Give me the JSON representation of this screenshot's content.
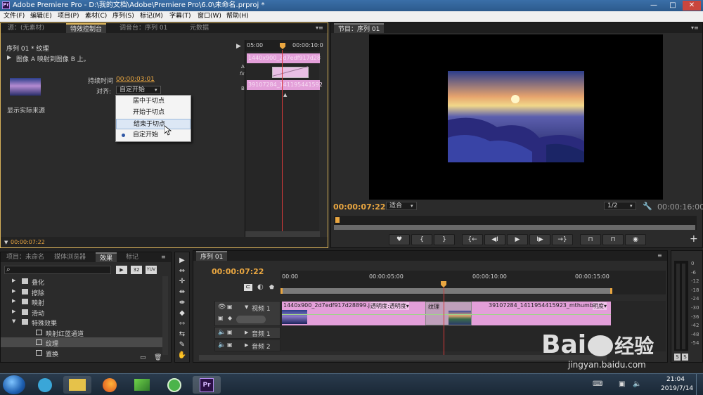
{
  "window": {
    "app_logo": "Pr",
    "title": "Adobe Premiere Pro - D:\\我的文档\\Adobe\\Premiere Pro\\6.0\\未命名.prproj *",
    "minimize": "—",
    "maximize": "□",
    "close": "✕"
  },
  "menu": [
    "文件(F)",
    "编辑(E)",
    "项目(P)",
    "素材(C)",
    "序列(S)",
    "标记(M)",
    "字幕(T)",
    "窗口(W)",
    "帮助(H)"
  ],
  "source_panel": {
    "tabs": [
      "源：(无素材)",
      "特效控制台",
      "调音台：序列 01",
      "元数据"
    ],
    "sequence_label": "序列 01 * 纹理",
    "description": "图像 A 映射到图像 B 上。",
    "duration_label": "持续时间",
    "duration_value": "00:00:03:01",
    "align_label": "对齐:",
    "align_value": "自定开始",
    "show_actual": "显示实际来源",
    "ruler_start": "05:00",
    "ruler_mid": "00:00:10:0",
    "track_a": "A",
    "track_b": "B",
    "fx": "fx",
    "clip_a_label": "1440x900_2d7edf917d28",
    "clip_b_label": "39107284_141195441592",
    "footer_timecode": "00:00:07:22",
    "dropdown_options": [
      "居中于切点",
      "开始于切点",
      "结束于切点",
      "自定开始"
    ],
    "dropdown_highlighted": 2,
    "dropdown_selected": 3
  },
  "program_panel": {
    "tab": "节目：序列 01",
    "timecode": "00:00:07:22",
    "fit": "适合",
    "resolution": "1/2",
    "duration": "00:00:16:00",
    "buttons": [
      "marker",
      "in-point",
      "out-point",
      "go-to-in",
      "step-back",
      "play",
      "step-forward",
      "go-to-out",
      "lift",
      "extract",
      "export-frame"
    ],
    "button_glyphs": [
      "♥",
      "{",
      "}",
      "{←",
      "◀I",
      "▶",
      "I▶",
      "→}",
      "⊓",
      "⊓",
      "◉"
    ],
    "add": "+"
  },
  "project_panel": {
    "tabs": [
      "项目：未命名",
      "媒体浏览器",
      "效果",
      "标记"
    ],
    "search_icon": "⌕",
    "chip_a": "▶",
    "chip_b": "32",
    "chip_c": "YUV",
    "tree": [
      {
        "label": "叠化",
        "type": "folder",
        "indent": 0
      },
      {
        "label": "擦除",
        "type": "folder",
        "indent": 0
      },
      {
        "label": "映射",
        "type": "folder",
        "indent": 0
      },
      {
        "label": "滑动",
        "type": "folder",
        "indent": 0
      },
      {
        "label": "特殊效果",
        "type": "folder-open",
        "indent": 0
      },
      {
        "label": "映射红蓝通道",
        "type": "effect",
        "indent": 1
      },
      {
        "label": "纹理",
        "type": "effect",
        "indent": 1,
        "selected": true
      },
      {
        "label": "置换",
        "type": "effect",
        "indent": 1
      }
    ]
  },
  "tools": [
    "▶",
    "⇔",
    "✛",
    "⇹",
    "⇼",
    "◆",
    "⇿",
    "⇆",
    "✎",
    "✋"
  ],
  "timeline_panel": {
    "tab": "序列 01",
    "timecode": "00:00:07:22",
    "ruler": [
      "00:00",
      "00:00:05:00",
      "00:00:10:00",
      "00:00:15:00"
    ],
    "video_track": "视频 1",
    "audio_tracks": [
      "音频 1",
      "音频 2"
    ],
    "clip1_label": "1440x900_2d7edf917d28899.jpg",
    "clip1_effect": "透明度:透明度▾",
    "transition_label": "纹理",
    "clip2_label": "39107284_1411954415923_mthumb.jpg",
    "clip2_effect": "明度▾"
  },
  "audio_meter": {
    "labels": [
      "0",
      "-6",
      "-12",
      "-18",
      "-24",
      "-30",
      "-36",
      "-42",
      "-48",
      "-54"
    ],
    "solo_left": "S",
    "solo_right": "S"
  },
  "taskbar": {
    "clock_time": "21:04",
    "clock_date": "2019/7/14",
    "pr_label": "Pr"
  },
  "watermark": {
    "brand": "Bai",
    "brand_cn": "经验",
    "url": "jingyan.baidu.com"
  },
  "colors": {
    "accent_orange": "#e9a640",
    "clip_pink": "#e39fd9",
    "playhead_red": "#d63a3a",
    "titlebar": "#3a6fa8"
  }
}
